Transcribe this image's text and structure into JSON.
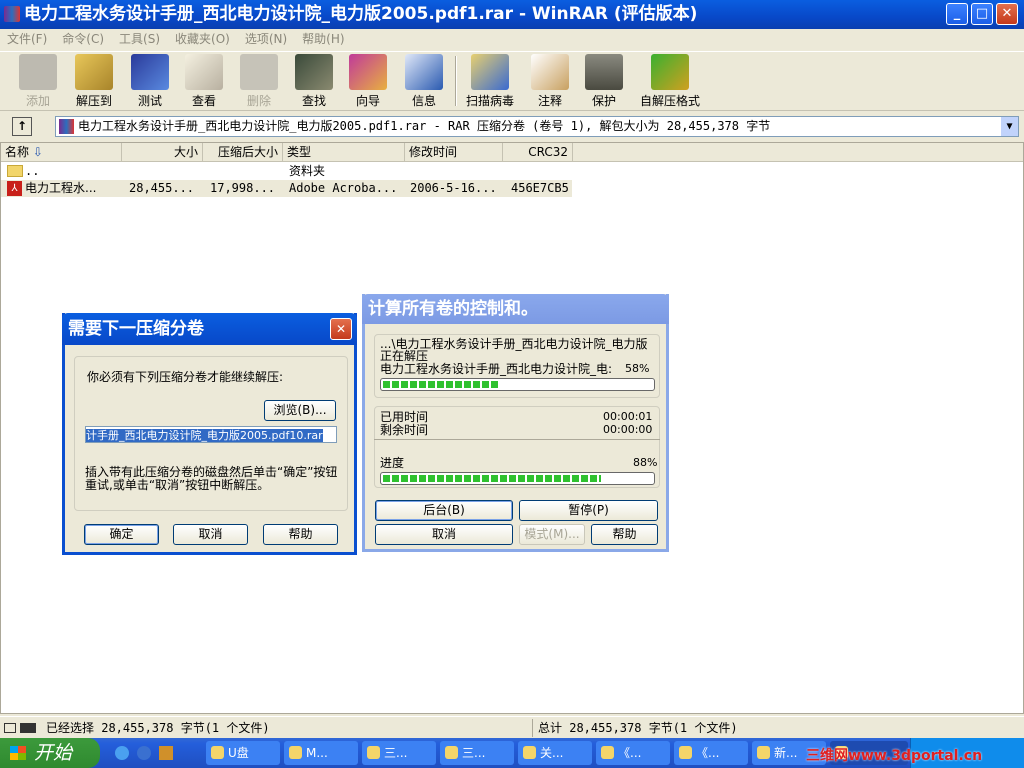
{
  "window": {
    "title": "电力工程水务设计手册_西北电力设计院_电力版2005.pdf1.rar - WinRAR (评估版本)",
    "controls": {
      "minimize": "_",
      "maximize": "□",
      "close": "✕"
    }
  },
  "menu": [
    "文件(F)",
    "命令(C)",
    "工具(S)",
    "收藏夹(O)",
    "选项(N)",
    "帮助(H)"
  ],
  "toolbar": [
    {
      "label": "添加",
      "icon": "add-icon",
      "enabled": false
    },
    {
      "label": "解压到",
      "icon": "extract-icon",
      "enabled": true
    },
    {
      "label": "测试",
      "icon": "test-icon",
      "enabled": true
    },
    {
      "label": "查看",
      "icon": "view-icon",
      "enabled": true
    },
    {
      "label": "删除",
      "icon": "delete-icon",
      "enabled": false
    },
    {
      "label": "查找",
      "icon": "find-icon",
      "enabled": true
    },
    {
      "label": "向导",
      "icon": "wizard-icon",
      "enabled": true
    },
    {
      "label": "信息",
      "icon": "info-icon",
      "enabled": true
    },
    {
      "label": "扫描病毒",
      "icon": "virus-scan-icon",
      "enabled": true
    },
    {
      "label": "注释",
      "icon": "comment-icon",
      "enabled": true
    },
    {
      "label": "保护",
      "icon": "protect-icon",
      "enabled": true
    },
    {
      "label": "自解压格式",
      "icon": "sfx-icon",
      "enabled": true
    }
  ],
  "address": "电力工程水务设计手册_西北电力设计院_电力版2005.pdf1.rar - RAR 压缩分卷 (卷号 1), 解包大小为 28,455,378 字节",
  "columns": [
    "名称",
    "大小",
    "压缩后大小",
    "类型",
    "修改时间",
    "CRC32"
  ],
  "rows": [
    {
      "name": "..",
      "size": "",
      "packed": "",
      "type": "资料夹",
      "modified": "",
      "crc": ""
    },
    {
      "name": "电力工程水...",
      "size": "28,455...",
      "packed": "17,998...",
      "type": "Adobe Acroba...",
      "modified": "2006-5-16...",
      "crc": "456E7CB5"
    }
  ],
  "status": {
    "left": "已经选择 28,455,378 字节(1 个文件)",
    "right": "总计 28,455,378 字节(1 个文件)"
  },
  "dialog_next_volume": {
    "title": "需要下一压缩分卷",
    "prompt": "你必须有下列压缩分卷才能继续解压:",
    "browse": "浏览(B)...",
    "filename": "计手册_西北电力设计院_电力版2005.pdf10.rar",
    "instructions": "插入带有此压缩分卷的磁盘然后单击“确定”按钮重试,或单击“取消”按钮中断解压。",
    "ok": "确定",
    "cancel": "取消",
    "help": "帮助"
  },
  "dialog_progress": {
    "title": "计算所有卷的控制和。",
    "path": "...\\电力工程水务设计手册_西北电力设计院_电力版",
    "action": "正在解压",
    "file": "电力工程水务设计手册_西北电力设计院_电:",
    "file_percent": "58%",
    "file_progress": 58,
    "elapsed_label": "已用时间",
    "elapsed": "00:00:01",
    "remaining_label": "剩余时间",
    "remaining": "00:00:00",
    "total_label": "进度",
    "total_percent": "88%",
    "total_progress": 88,
    "background": "后台(B)",
    "pause": "暂停(P)",
    "cancel": "取消",
    "mode": "模式(M)...",
    "help": "帮助"
  },
  "taskbar": {
    "start": "开始",
    "tasks": [
      "U盘",
      "M...",
      "三...",
      "三...",
      "关...",
      "《...",
      "《...",
      "新...",
      ""
    ],
    "watermark": "三维网www.3dportal.cn"
  }
}
